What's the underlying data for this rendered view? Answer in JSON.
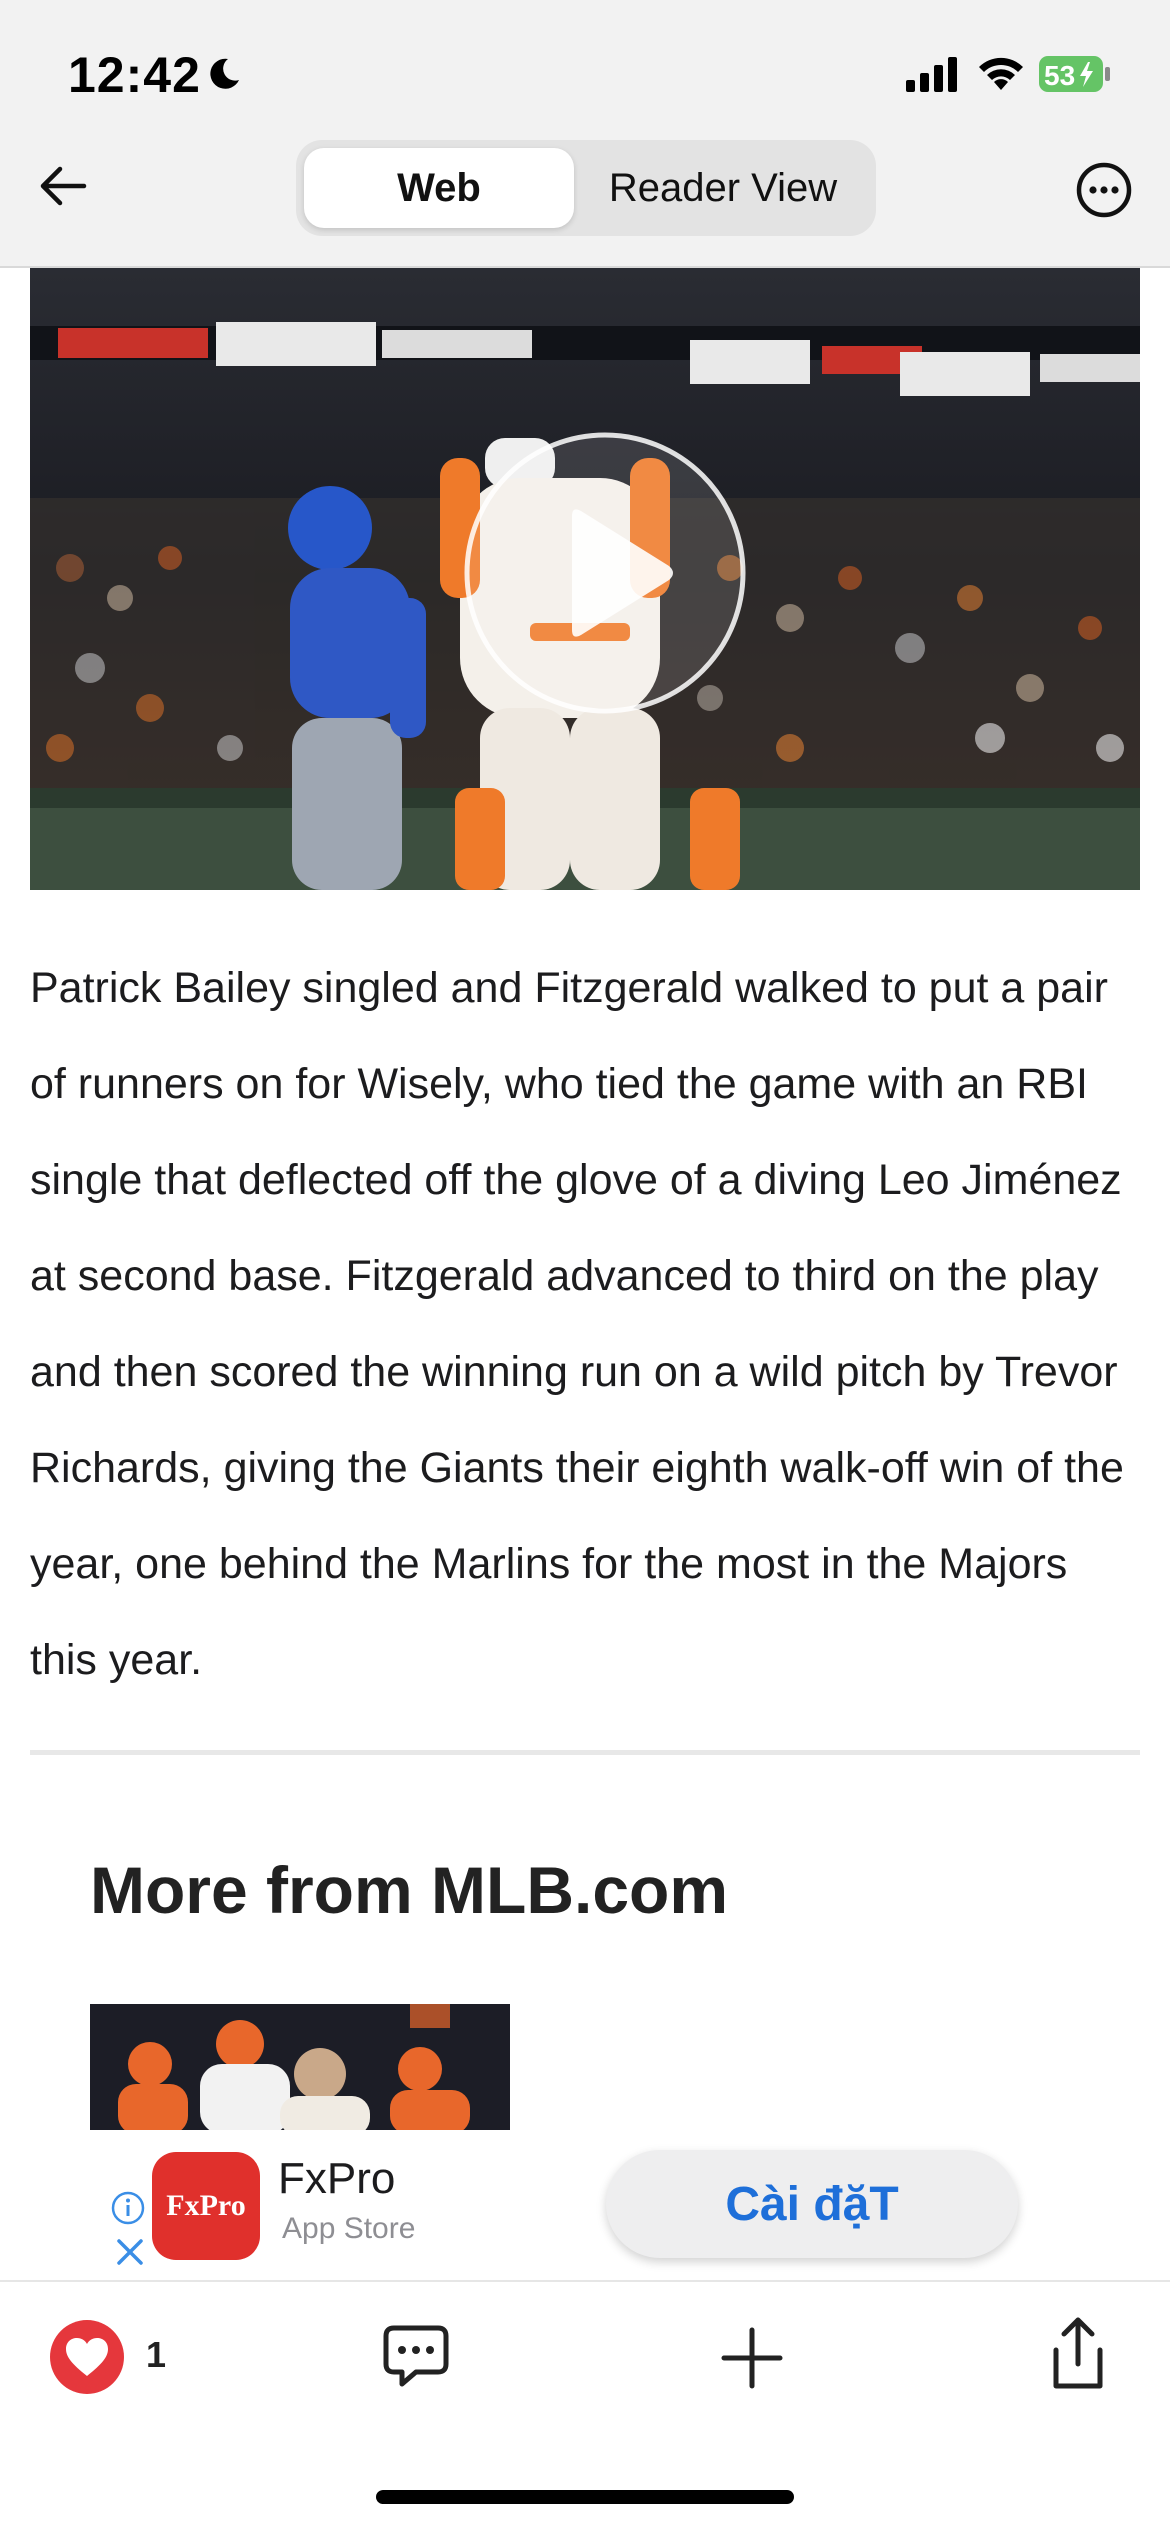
{
  "status_bar": {
    "time": "12:42",
    "battery": "53"
  },
  "nav": {
    "tabs": [
      {
        "label": "Web",
        "selected": true
      },
      {
        "label": "Reader View",
        "selected": false
      }
    ],
    "icons": [
      "back-arrow-icon",
      "more-options-icon"
    ]
  },
  "video": {
    "state": "paused",
    "icon": "play-icon"
  },
  "article": {
    "paragraph": "Patrick Bailey singled and Fitzgerald walked to put a pair of runners on for Wisely, who tied the game with an RBI single that deflected off the glove of a diving Leo Jiménez at second base. Fitzgerald advanced to third on the play and then scored the winning run on a wild pitch by Trevor Richards, giving the Giants their eighth walk-off win of the year, one behind the Marlins for the most in the Majors this year."
  },
  "more_section": {
    "heading": "More from MLB.com"
  },
  "ad": {
    "app_name": "FxPro",
    "icon_text": "FxPro",
    "store": "App Store",
    "install_label": "Cài đặT"
  },
  "toolbar": {
    "like_count": "1",
    "icons": [
      "heart-icon",
      "comment-icon",
      "plus-icon",
      "share-icon"
    ]
  },
  "colors": {
    "accent_blue": "#1e6fd9",
    "like_red": "#e5373c",
    "ad_red": "#e0302c",
    "battery_green": "#65c466"
  }
}
